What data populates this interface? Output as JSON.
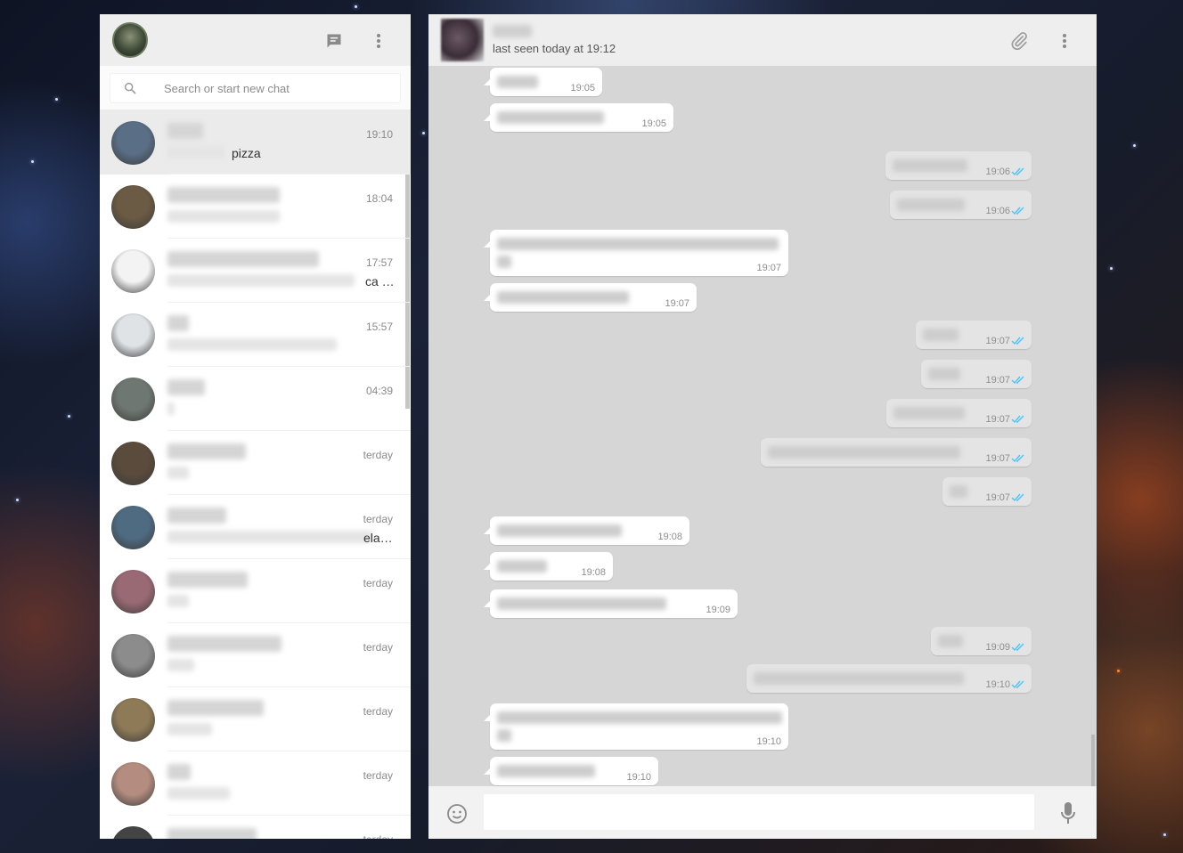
{
  "sidebar": {
    "search_placeholder": "Search or start new chat",
    "chats": [
      {
        "time": "19:10",
        "preview_word": "pizza",
        "active": true,
        "avatar_color": "#5a6e86"
      },
      {
        "time": "18:04",
        "avatar_color": "#6b5a44"
      },
      {
        "time": "17:57",
        "preview_word": "ca …",
        "avatar_color": "#f3f3f3"
      },
      {
        "time": "15:57",
        "avatar_color": "#dfe3e6"
      },
      {
        "time": "04:39",
        "avatar_color": "#6f7772"
      },
      {
        "time": "terday",
        "avatar_color": "#5b4b3d"
      },
      {
        "time": "terday",
        "preview_word": "ela…",
        "avatar_color": "#4f6b82"
      },
      {
        "time": "terday",
        "avatar_color": "#9a6a74"
      },
      {
        "time": "terday",
        "avatar_color": "#8c8c8c"
      },
      {
        "time": "terday",
        "avatar_color": "#8e7a57"
      },
      {
        "time": "terday",
        "avatar_color": "#b48c80"
      },
      {
        "time": "terday",
        "avatar_color": "#444444"
      }
    ]
  },
  "conversation": {
    "status": "last seen today at 19:12",
    "messages": [
      {
        "dir": "in",
        "time": "19:05"
      },
      {
        "dir": "in",
        "time": "19:05"
      },
      {
        "dir": "out",
        "time": "19:06"
      },
      {
        "dir": "out",
        "time": "19:06"
      },
      {
        "dir": "in",
        "time": "19:07"
      },
      {
        "dir": "in",
        "time": "19:07"
      },
      {
        "dir": "out",
        "time": "19:07"
      },
      {
        "dir": "out",
        "time": "19:07"
      },
      {
        "dir": "out",
        "time": "19:07"
      },
      {
        "dir": "out",
        "time": "19:07"
      },
      {
        "dir": "out",
        "time": "19:07"
      },
      {
        "dir": "in",
        "time": "19:08"
      },
      {
        "dir": "in",
        "time": "19:08"
      },
      {
        "dir": "in",
        "time": "19:09"
      },
      {
        "dir": "out",
        "time": "19:09"
      },
      {
        "dir": "out",
        "time": "19:10"
      },
      {
        "dir": "in",
        "time": "19:10"
      },
      {
        "dir": "in",
        "time": "19:10"
      }
    ],
    "composer_placeholder": ""
  },
  "icons": {
    "new_chat": "message-icon",
    "menu": "more-vert-icon",
    "search": "search-icon",
    "attach": "paperclip-icon",
    "emoji": "smiley-icon",
    "mic": "microphone-icon"
  },
  "colors": {
    "read_tick": "#4fc3f7",
    "panel_bg": "#d6d6d6",
    "header_bg": "#eeeeee"
  }
}
